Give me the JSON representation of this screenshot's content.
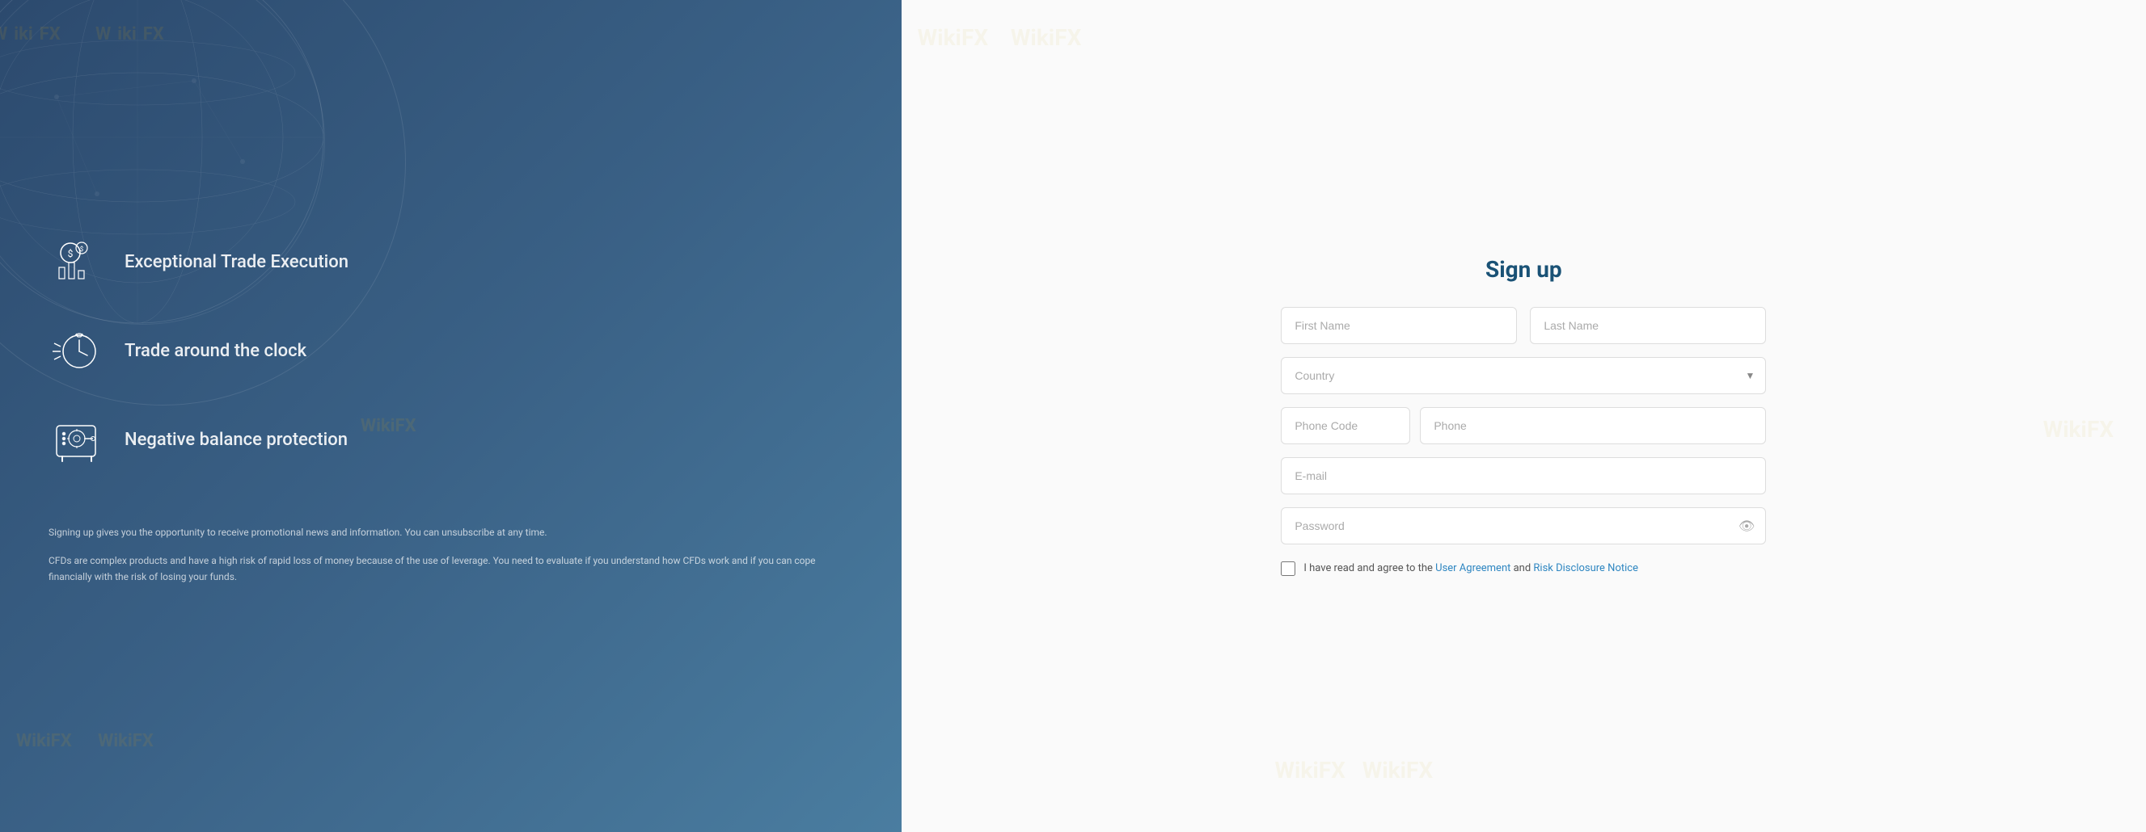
{
  "left": {
    "features": [
      {
        "id": "trade-execution",
        "icon": "chart-icon",
        "text": "Exceptional Trade Execution"
      },
      {
        "id": "trade-clock",
        "icon": "clock-icon",
        "text": "Trade around the clock"
      },
      {
        "id": "negative-balance",
        "icon": "safe-icon",
        "text": "Negative balance protection"
      }
    ],
    "disclaimers": [
      "Signing up gives you the opportunity to receive promotional news and information. You can unsubscribe at any time.",
      "CFDs are complex products and have a high risk of rapid loss of money because of the use of leverage. You need to evaluate if you understand how CFDs work and if you can cope financially with the risk of losing your funds."
    ]
  },
  "right": {
    "title": "Sign up",
    "form": {
      "first_name_placeholder": "First Name",
      "last_name_placeholder": "Last Name",
      "country_placeholder": "Country",
      "phone_code_placeholder": "Phone Code",
      "phone_placeholder": "Phone",
      "email_placeholder": "E-mail",
      "password_placeholder": "Password"
    },
    "agreement": {
      "text_before": "I have read and agree to the ",
      "user_agreement_label": "User Agreement",
      "text_between": " and ",
      "risk_disclosure_label": "Risk Disclosure Notice"
    }
  },
  "watermark": "WikiFX"
}
